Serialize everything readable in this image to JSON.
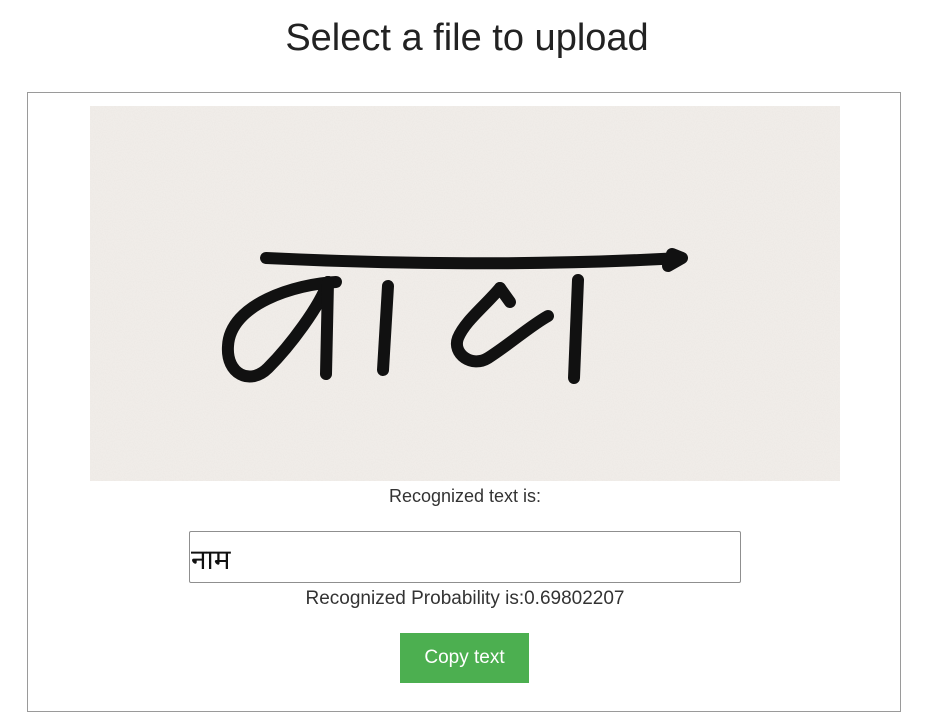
{
  "page": {
    "title": "Select a file to upload"
  },
  "result": {
    "recognized_label": "Recognized text is:",
    "recognized_text": "नाम",
    "probability_text": "Recognized Probability is:0.69802207"
  },
  "actions": {
    "copy_label": "Copy text"
  },
  "colors": {
    "button_bg": "#4caf50",
    "paper_bg": "#f2eeea",
    "ink": "#111111"
  }
}
